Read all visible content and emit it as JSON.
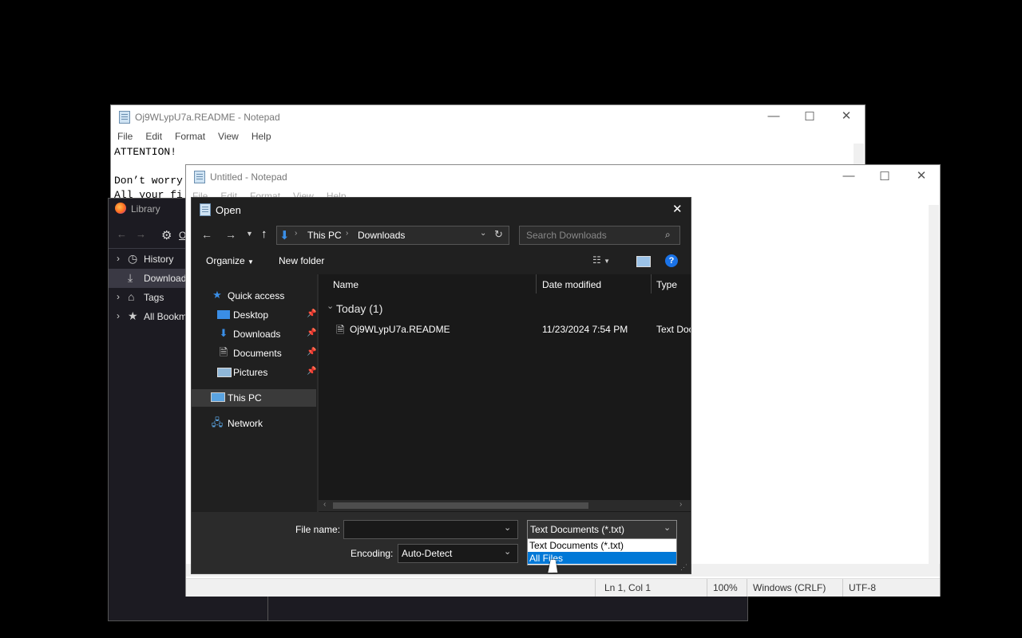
{
  "notepad_back": {
    "title": "Oj9WLypU7a.README - Notepad",
    "menu": [
      "File",
      "Edit",
      "Format",
      "View",
      "Help"
    ],
    "lines": [
      "ATTENTION!",
      "",
      "Don’t worry",
      "All your fi"
    ]
  },
  "library": {
    "title": "Library",
    "organize_label": "O",
    "items": [
      {
        "label": "History",
        "icon": "history-icon"
      },
      {
        "label": "Download",
        "icon": "download-icon"
      },
      {
        "label": "Tags",
        "icon": "tag-icon"
      },
      {
        "label": "All Bookm",
        "icon": "star-icon"
      }
    ]
  },
  "notepad_front": {
    "title": "Untitled - Notepad",
    "menu": [
      "File",
      "Edit",
      "Format",
      "View",
      "Help"
    ],
    "status": {
      "position": "Ln 1, Col 1",
      "zoom": "100%",
      "eol": "Windows (CRLF)",
      "encoding": "UTF-8"
    }
  },
  "dialog": {
    "title": "Open",
    "breadcrumb": [
      "This PC",
      "Downloads"
    ],
    "search_placeholder": "Search Downloads",
    "toolbar": {
      "organize": "Organize",
      "new_folder": "New folder"
    },
    "nav": {
      "quick_access": "Quick access",
      "items": [
        {
          "label": "Desktop",
          "pinned": true
        },
        {
          "label": "Downloads",
          "pinned": true
        },
        {
          "label": "Documents",
          "pinned": true
        },
        {
          "label": "Pictures",
          "pinned": true
        }
      ],
      "this_pc": "This PC",
      "network": "Network"
    },
    "columns": [
      "Name",
      "Date modified",
      "Type"
    ],
    "group": "Today (1)",
    "files": [
      {
        "name": "Oj9WLypU7a.README",
        "date": "11/23/2024 7:54 PM",
        "type": "Text Doc"
      }
    ],
    "file_name_label": "File name:",
    "file_name_value": "",
    "encoding_label": "Encoding:",
    "encoding_value": "Auto-Detect",
    "filetype_selected": "Text Documents (*.txt)",
    "filetype_options": [
      "Text Documents (*.txt)",
      "All Files"
    ],
    "filetype_highlighted": "All Files"
  },
  "colors": {
    "dialog_bg": "#202020",
    "selection": "#0078d7",
    "library_bg": "#1c1b22"
  }
}
